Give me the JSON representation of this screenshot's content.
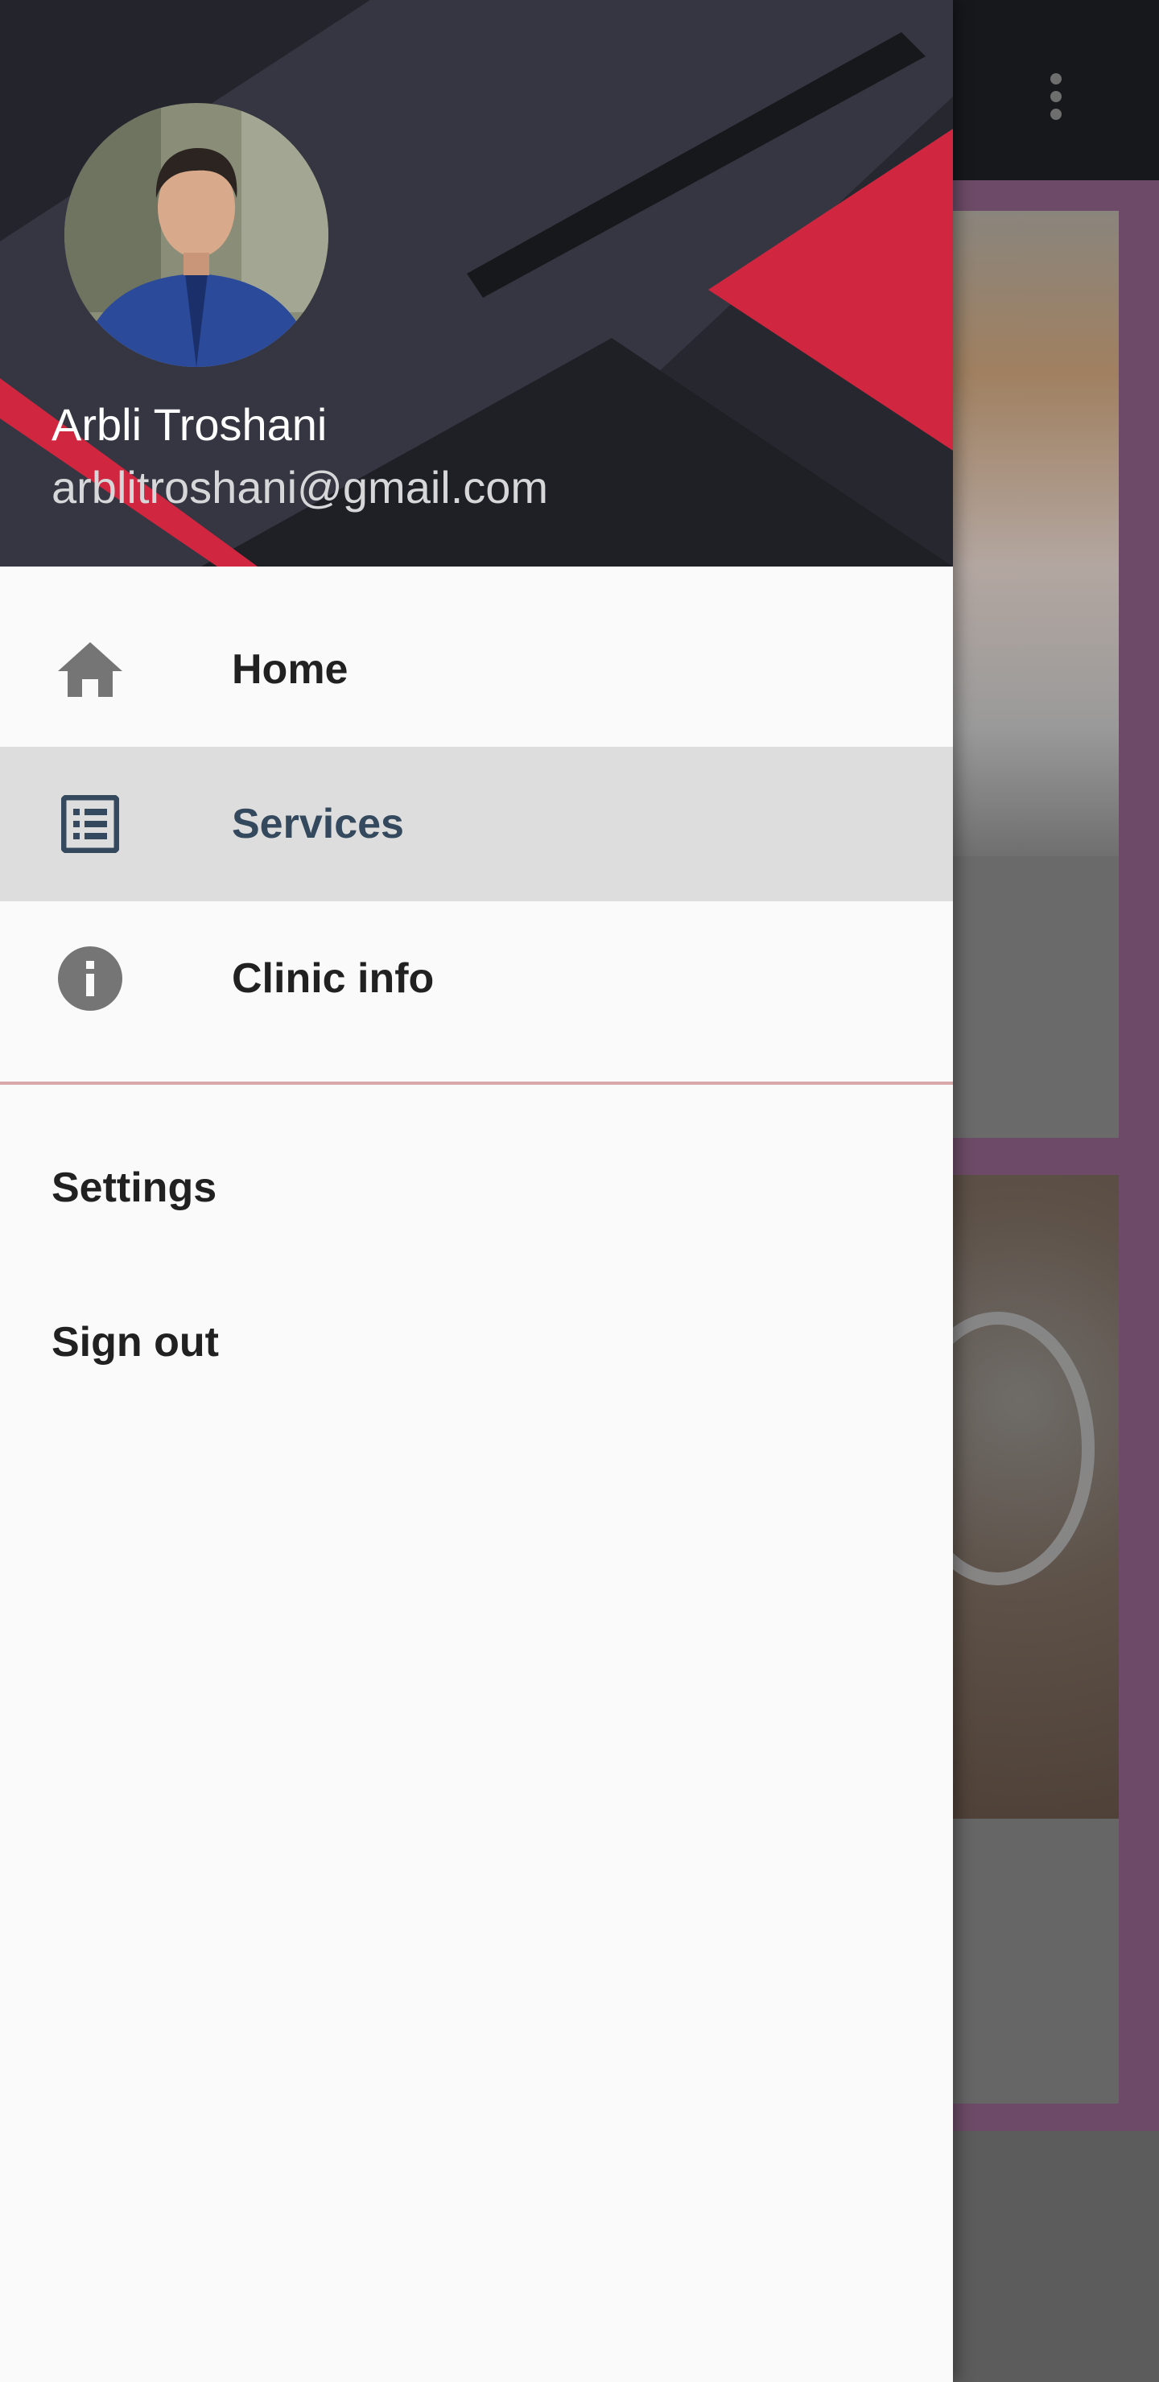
{
  "header": {
    "user_name": "Arbli Troshani",
    "user_email": "arblitroshani@gmail.com",
    "avatar_icon": "profile-photo"
  },
  "menu": {
    "items": [
      {
        "label": "Home",
        "icon": "home-icon",
        "active": false
      },
      {
        "label": "Services",
        "icon": "list-icon",
        "active": true
      },
      {
        "label": "Clinic info",
        "icon": "info-icon",
        "active": false
      }
    ]
  },
  "secondary": {
    "items": [
      {
        "label": "Settings"
      },
      {
        "label": "Sign out"
      }
    ]
  },
  "toolbar": {
    "overflow_icon": "more-vert-icon"
  },
  "colors": {
    "header_dark": "#2d2e36",
    "accent_red": "#d0263f",
    "active_bg": "#dddddd",
    "active_text": "#34495e",
    "drawer_bg": "#fafafa"
  }
}
